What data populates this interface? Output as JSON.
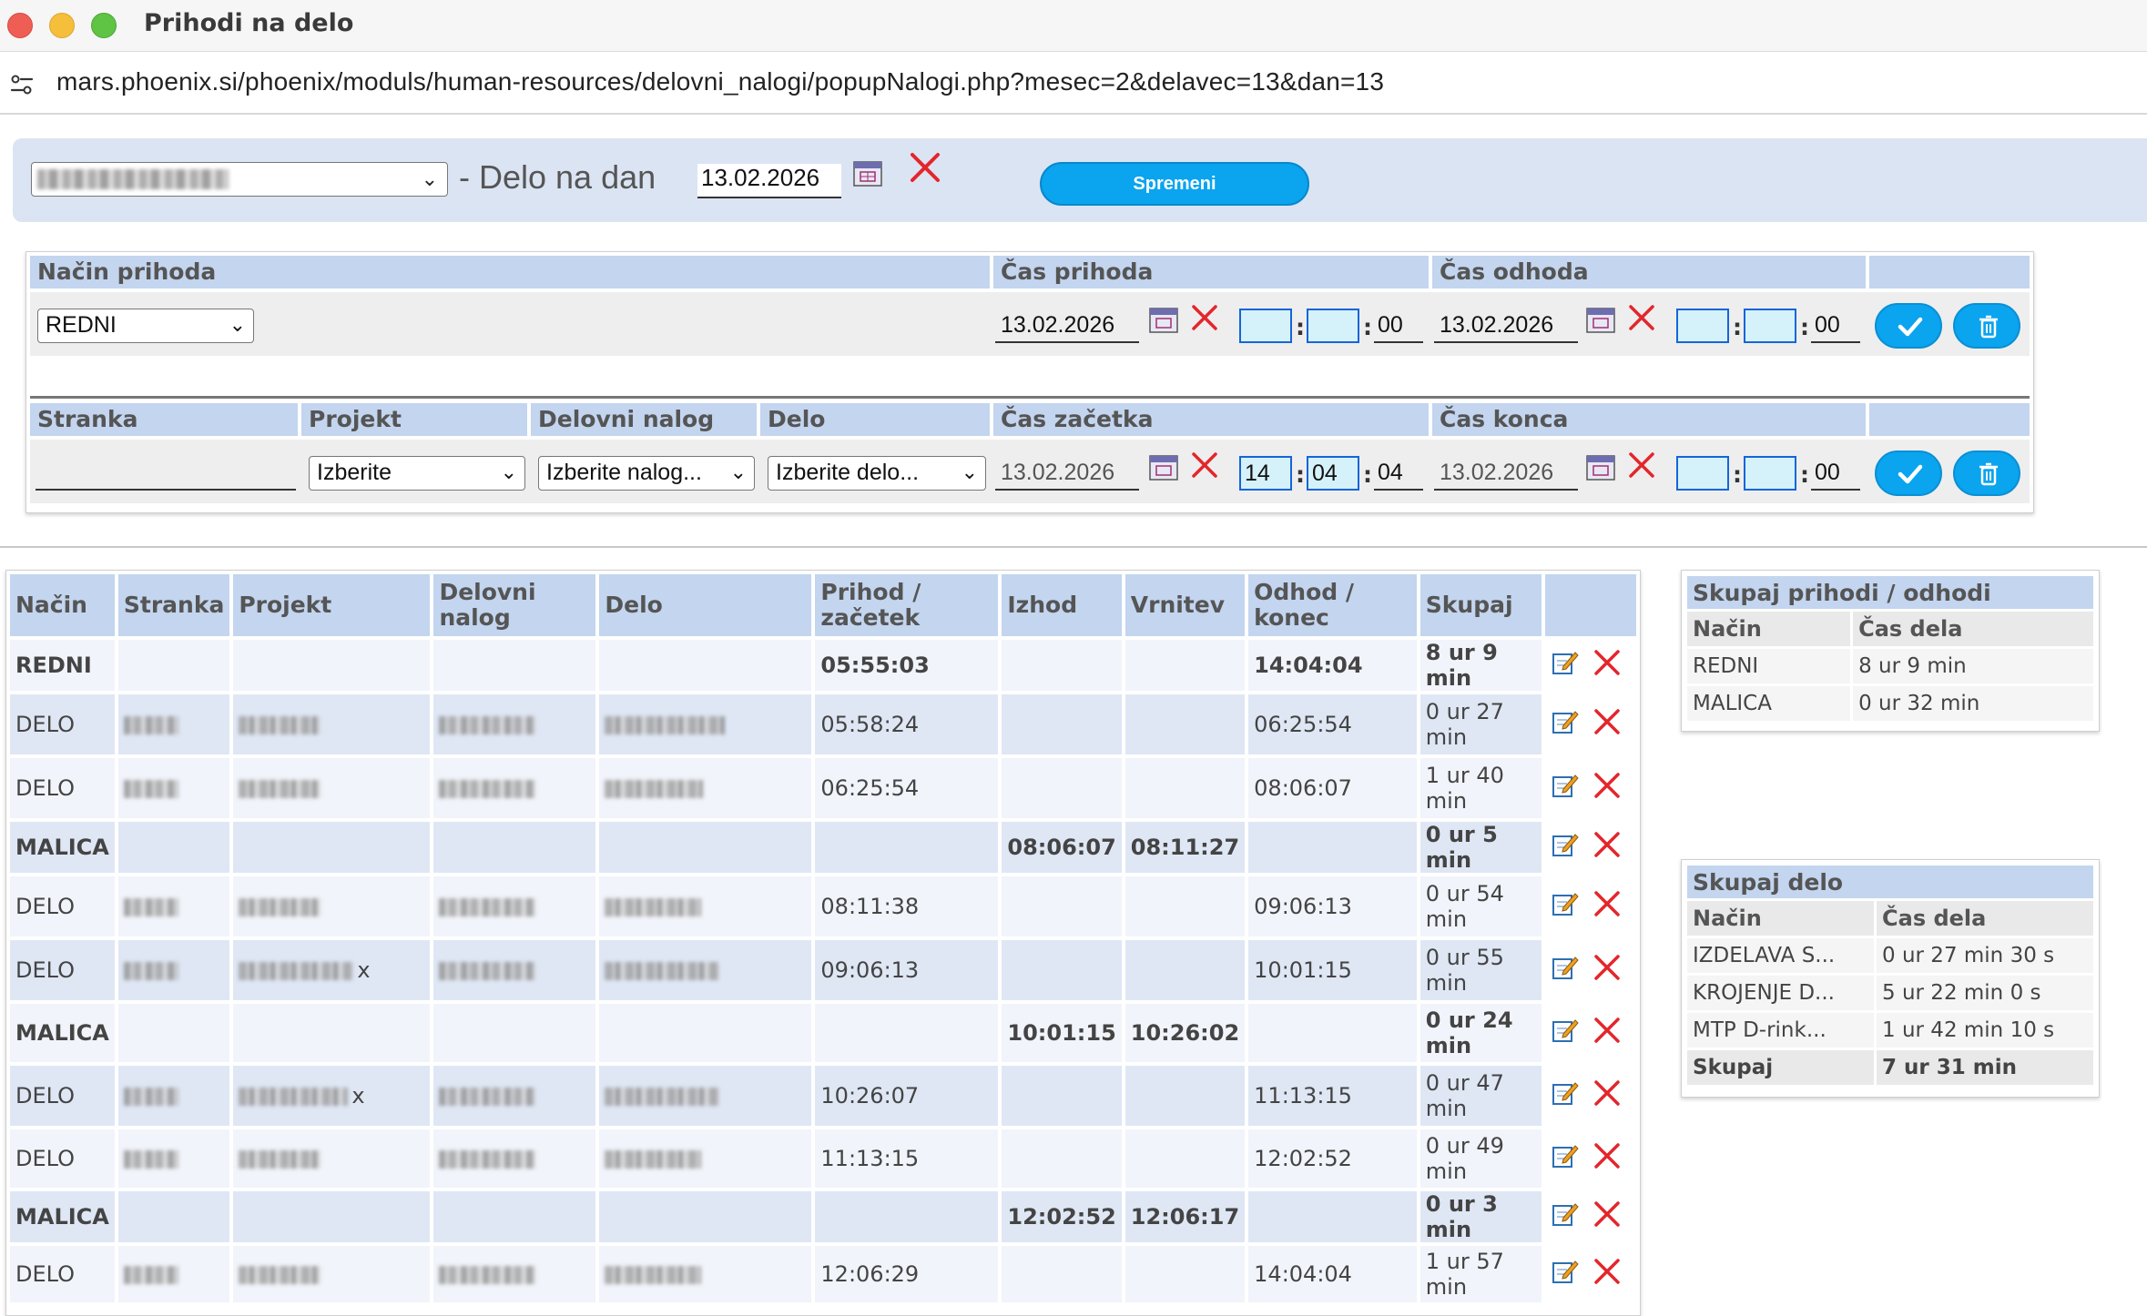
{
  "window": {
    "title": "Prihodi na delo"
  },
  "browser": {
    "url": "mars.phoenix.si/phoenix/moduls/human-resources/delovni_nalogi/popupNalogi.php?mesec=2&delavec=13&dan=13"
  },
  "topbar": {
    "label": "- Delo na dan",
    "date": "13.02.2026",
    "submit_label": "Spremeni"
  },
  "arrival_form": {
    "headers": {
      "method": "Način prihoda",
      "arrival": "Čas prihoda",
      "departure": "Čas odhoda"
    },
    "method_value": "REDNI",
    "arrival_date": "13.02.2026",
    "arrival_hour": "",
    "arrival_min": "",
    "arrival_sec": "00",
    "departure_date": "13.02.2026",
    "departure_hour": "",
    "departure_min": "",
    "departure_sec": "00",
    "colon": ":"
  },
  "work_form": {
    "headers": {
      "client": "Stranka",
      "project": "Projekt",
      "work_order": "Delovni nalog",
      "work": "Delo",
      "start": "Čas začetka",
      "end": "Čas konca"
    },
    "client_value": "",
    "project_value": "Izberite",
    "order_value": "Izberite nalog...",
    "work_value": "Izberite delo...",
    "start_date": "13.02.2026",
    "start_hour": "14",
    "start_min": "04",
    "start_sec": "04",
    "end_date": "13.02.2026",
    "end_hour": "",
    "end_min": "",
    "end_sec": "00"
  },
  "main_table": {
    "headers": {
      "method": "Način",
      "client": "Stranka",
      "project": "Projekt",
      "order_a": "Delovni",
      "order_b": "nalog",
      "work": "Delo",
      "in_a": "Prihod /",
      "in_b": "začetek",
      "exit": "Izhod",
      "return": "Vrnitev",
      "out_a": "Odhod /",
      "out_b": "konec",
      "total": "Skupaj"
    },
    "rows": [
      {
        "method": "REDNI",
        "in": "05:55:03",
        "exit": "",
        "return": "",
        "out": "14:04:04",
        "total": "8 ur 9 min",
        "bold": true
      },
      {
        "method": "DELO",
        "in": "05:58:24",
        "exit": "",
        "return": "",
        "out": "06:25:54",
        "total": "0 ur 27 min",
        "bold": false
      },
      {
        "method": "DELO",
        "in": "06:25:54",
        "exit": "",
        "return": "",
        "out": "08:06:07",
        "total": "1 ur 40 min",
        "bold": false
      },
      {
        "method": "MALICA",
        "in": "",
        "exit": "08:06:07",
        "return": "08:11:27",
        "out": "",
        "total": "0 ur 5 min",
        "bold": true
      },
      {
        "method": "DELO",
        "in": "08:11:38",
        "exit": "",
        "return": "",
        "out": "09:06:13",
        "total": "0 ur 54 min",
        "bold": false
      },
      {
        "method": "DELO",
        "in": "09:06:13",
        "exit": "",
        "return": "",
        "out": "10:01:15",
        "total": "0 ur 55 min",
        "bold": false
      },
      {
        "method": "MALICA",
        "in": "",
        "exit": "10:01:15",
        "return": "10:26:02",
        "out": "",
        "total": "0 ur 24 min",
        "bold": true
      },
      {
        "method": "DELO",
        "in": "10:26:07",
        "exit": "",
        "return": "",
        "out": "11:13:15",
        "total": "0 ur 47 min",
        "bold": false
      },
      {
        "method": "DELO",
        "in": "11:13:15",
        "exit": "",
        "return": "",
        "out": "12:02:52",
        "total": "0 ur 49 min",
        "bold": false
      },
      {
        "method": "MALICA",
        "in": "",
        "exit": "12:02:52",
        "return": "12:06:17",
        "out": "",
        "total": "0 ur 3 min",
        "bold": true
      },
      {
        "method": "DELO",
        "in": "12:06:29",
        "exit": "",
        "return": "",
        "out": "14:04:04",
        "total": "1 ur 57 min",
        "bold": false
      }
    ],
    "x_marks": {
      "r5": "x",
      "r7": "x"
    }
  },
  "summary_inout": {
    "title": "Skupaj prihodi / odhodi",
    "col_method": "Način",
    "col_time": "Čas dela",
    "rows": [
      {
        "method": "REDNI",
        "time": "8 ur 9 min"
      },
      {
        "method": "MALICA",
        "time": "0 ur 32 min"
      }
    ]
  },
  "summary_work": {
    "title": "Skupaj delo",
    "col_method": "Način",
    "col_time": "Čas dela",
    "rows": [
      {
        "method": "IZDELAVA S...",
        "time": "0 ur 27 min 30 s"
      },
      {
        "method": "KROJENJE D...",
        "time": "5 ur 22 min 0 s"
      },
      {
        "method": "MTP D-rink...",
        "time": "1 ur 42 min 10 s"
      }
    ],
    "total_label": "Skupaj",
    "total_value": "7 ur 31 min"
  },
  "colors": {
    "accent": "#0aa4ef",
    "header_bg": "#c3d5ef",
    "delete_red": "#e3262b"
  }
}
